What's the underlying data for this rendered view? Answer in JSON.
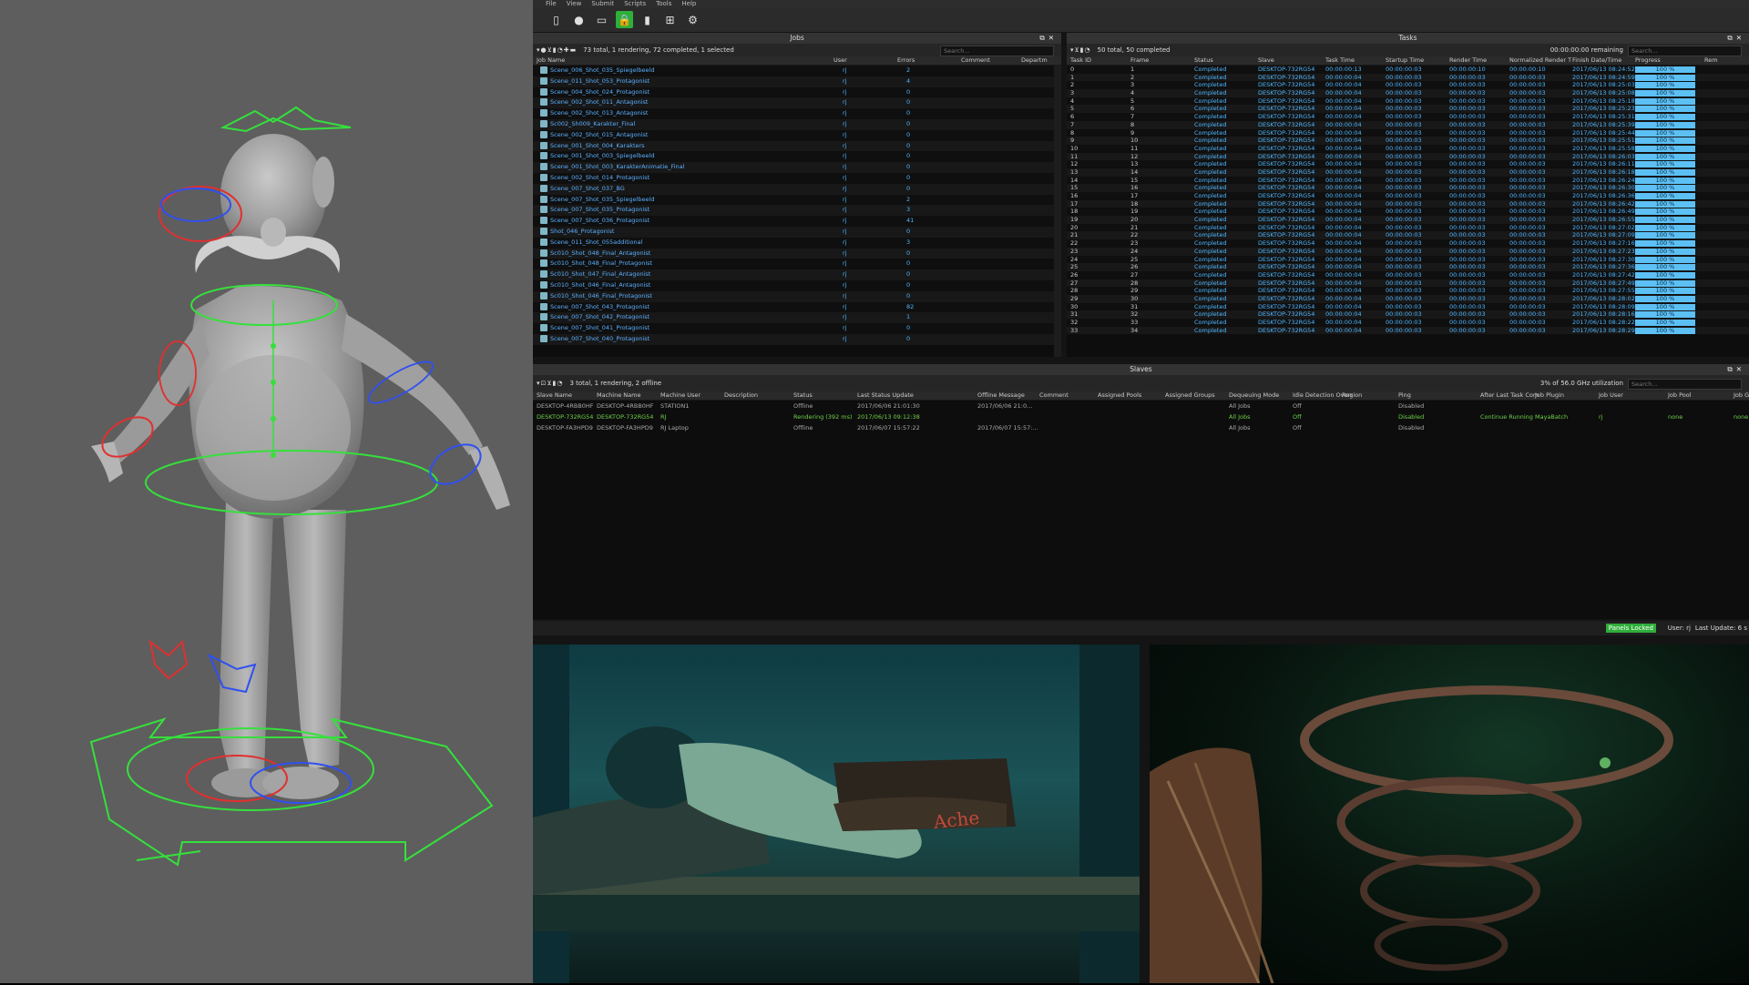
{
  "menu": [
    "File",
    "View",
    "Submit",
    "Scripts",
    "Tools",
    "Help"
  ],
  "toolbar_icons": [
    "monitor-icon",
    "user-icon",
    "window-icon",
    "lock-icon",
    "bookmark-icon",
    "network-icon",
    "gear-icon"
  ],
  "jobs": {
    "title": "Jobs",
    "summary": "73 total, 1 rendering, 72 completed, 1 selected",
    "search_placeholder": "Search...",
    "columns": [
      "Job Name",
      "User",
      "Errors",
      "Comment",
      "Departm"
    ],
    "rows": [
      {
        "name": "Scene_006_Shot_035_Spiegelbeeld",
        "user": "rj",
        "errors": "2"
      },
      {
        "name": "Scene_011_Shot_053_Protagonist",
        "user": "rj",
        "errors": "4"
      },
      {
        "name": "Scene_004_Shot_024_Protagonist",
        "user": "rj",
        "errors": "0"
      },
      {
        "name": "Scene_002_Shot_011_Antagonist",
        "user": "rj",
        "errors": "0"
      },
      {
        "name": "Scene_002_Shot_013_Antagonist",
        "user": "rj",
        "errors": "0"
      },
      {
        "name": "Sc002_Sh009_Karakter_Final",
        "user": "rj",
        "errors": "0"
      },
      {
        "name": "Scene_002_Shot_015_Antagonist",
        "user": "rj",
        "errors": "0"
      },
      {
        "name": "Scene_001_Shot_004_Karakters",
        "user": "rj",
        "errors": "0"
      },
      {
        "name": "Scene_001_Shot_003_Spiegelbeeld",
        "user": "rj",
        "errors": "0"
      },
      {
        "name": "Scene_001_Shot_003_KarakterAnimatie_Final",
        "user": "rj",
        "errors": "0"
      },
      {
        "name": "Scene_002_Shot_014_Protagonist",
        "user": "rj",
        "errors": "0"
      },
      {
        "name": "Scene_007_Shot_037_BG",
        "user": "rj",
        "errors": "0"
      },
      {
        "name": "Scene_007_Shot_035_Spiegelbeeld",
        "user": "rj",
        "errors": "2"
      },
      {
        "name": "Scene_007_Shot_035_Protagonist",
        "user": "rj",
        "errors": "3"
      },
      {
        "name": "Scene_007_Shot_036_Protagonist",
        "user": "rj",
        "errors": "41"
      },
      {
        "name": "Shot_046_Protagonist",
        "user": "rj",
        "errors": "0"
      },
      {
        "name": "Scene_011_Shot_055additional",
        "user": "rj",
        "errors": "3"
      },
      {
        "name": "Sc010_Shot_048_Final_Antagonist",
        "user": "rj",
        "errors": "0"
      },
      {
        "name": "Sc010_Shot_048_Final_Protagonist",
        "user": "rj",
        "errors": "0"
      },
      {
        "name": "Sc010_Shot_047_Final_Antagonist",
        "user": "rj",
        "errors": "0"
      },
      {
        "name": "Sc010_Shot_046_Final_Antagonist",
        "user": "rj",
        "errors": "0"
      },
      {
        "name": "Sc010_Shot_046_Final_Protagonist",
        "user": "rj",
        "errors": "0"
      },
      {
        "name": "Scene_007_Shot_043_Protagonist",
        "user": "rj",
        "errors": "82"
      },
      {
        "name": "Scene_007_Shot_042_Protagonist",
        "user": "rj",
        "errors": "1"
      },
      {
        "name": "Scene_007_Shot_041_Protagonist",
        "user": "rj",
        "errors": "0"
      },
      {
        "name": "Scene_007_Shot_040_Protagonist",
        "user": "rj",
        "errors": "0"
      }
    ]
  },
  "tasks": {
    "title": "Tasks",
    "summary": "50 total, 50 completed",
    "remaining": "00:00:00:00 remaining",
    "search_placeholder": "Search...",
    "columns": [
      "Task ID",
      "Frame",
      "Status",
      "Slave",
      "Task Time",
      "Startup Time",
      "Render Time",
      "Normalized Render T",
      "Finish Date/Time",
      "Progress",
      "Rem"
    ],
    "rows": [
      {
        "id": "0",
        "frame": "1",
        "status": "Completed",
        "slave": "DESKTOP-732RG54",
        "task_time": "00:00:00:13",
        "startup": "00:00:00:03",
        "render": "00:00:00:10",
        "norm": "00:00:00:10",
        "finish": "2017/06/13 08:24:52",
        "progress": "100 %"
      },
      {
        "id": "1",
        "frame": "2",
        "status": "Completed",
        "slave": "DESKTOP-732RG54",
        "task_time": "00:00:00:04",
        "startup": "00:00:00:03",
        "render": "00:00:00:03",
        "norm": "00:00:00:03",
        "finish": "2017/06/13 08:24:59",
        "progress": "100 %"
      },
      {
        "id": "2",
        "frame": "3",
        "status": "Completed",
        "slave": "DESKTOP-732RG54",
        "task_time": "00:00:00:04",
        "startup": "00:00:00:03",
        "render": "00:00:00:03",
        "norm": "00:00:00:03",
        "finish": "2017/06/13 08:25:03",
        "progress": "100 %"
      },
      {
        "id": "3",
        "frame": "4",
        "status": "Completed",
        "slave": "DESKTOP-732RG54",
        "task_time": "00:00:00:04",
        "startup": "00:00:00:03",
        "render": "00:00:00:03",
        "norm": "00:00:00:03",
        "finish": "2017/06/13 08:25:08",
        "progress": "100 %"
      },
      {
        "id": "4",
        "frame": "5",
        "status": "Completed",
        "slave": "DESKTOP-732RG54",
        "task_time": "00:00:00:04",
        "startup": "00:00:00:03",
        "render": "00:00:00:03",
        "norm": "00:00:00:03",
        "finish": "2017/06/13 08:25:18",
        "progress": "100 %"
      },
      {
        "id": "5",
        "frame": "6",
        "status": "Completed",
        "slave": "DESKTOP-732RG54",
        "task_time": "00:00:00:04",
        "startup": "00:00:00:03",
        "render": "00:00:00:03",
        "norm": "00:00:00:03",
        "finish": "2017/06/13 08:25:23",
        "progress": "100 %"
      },
      {
        "id": "6",
        "frame": "7",
        "status": "Completed",
        "slave": "DESKTOP-732RG54",
        "task_time": "00:00:00:04",
        "startup": "00:00:00:03",
        "render": "00:00:00:03",
        "norm": "00:00:00:03",
        "finish": "2017/06/13 08:25:31",
        "progress": "100 %"
      },
      {
        "id": "7",
        "frame": "8",
        "status": "Completed",
        "slave": "DESKTOP-732RG54",
        "task_time": "00:00:00:04",
        "startup": "00:00:00:03",
        "render": "00:00:00:03",
        "norm": "00:00:00:03",
        "finish": "2017/06/13 08:25:39",
        "progress": "100 %"
      },
      {
        "id": "8",
        "frame": "9",
        "status": "Completed",
        "slave": "DESKTOP-732RG54",
        "task_time": "00:00:00:04",
        "startup": "00:00:00:03",
        "render": "00:00:00:03",
        "norm": "00:00:00:03",
        "finish": "2017/06/13 08:25:44",
        "progress": "100 %"
      },
      {
        "id": "9",
        "frame": "10",
        "status": "Completed",
        "slave": "DESKTOP-732RG54",
        "task_time": "00:00:00:04",
        "startup": "00:00:00:03",
        "render": "00:00:00:03",
        "norm": "00:00:00:03",
        "finish": "2017/06/13 08:25:51",
        "progress": "100 %"
      },
      {
        "id": "10",
        "frame": "11",
        "status": "Completed",
        "slave": "DESKTOP-732RG54",
        "task_time": "00:00:00:04",
        "startup": "00:00:00:03",
        "render": "00:00:00:03",
        "norm": "00:00:00:03",
        "finish": "2017/06/13 08:25:58",
        "progress": "100 %"
      },
      {
        "id": "11",
        "frame": "12",
        "status": "Completed",
        "slave": "DESKTOP-732RG54",
        "task_time": "00:00:00:04",
        "startup": "00:00:00:03",
        "render": "00:00:00:03",
        "norm": "00:00:00:03",
        "finish": "2017/06/13 08:26:03",
        "progress": "100 %"
      },
      {
        "id": "12",
        "frame": "13",
        "status": "Completed",
        "slave": "DESKTOP-732RG54",
        "task_time": "00:00:00:04",
        "startup": "00:00:00:03",
        "render": "00:00:00:03",
        "norm": "00:00:00:03",
        "finish": "2017/06/13 08:26:11",
        "progress": "100 %"
      },
      {
        "id": "13",
        "frame": "14",
        "status": "Completed",
        "slave": "DESKTOP-732RG54",
        "task_time": "00:00:00:04",
        "startup": "00:00:00:03",
        "render": "00:00:00:03",
        "norm": "00:00:00:03",
        "finish": "2017/06/13 08:26:18",
        "progress": "100 %"
      },
      {
        "id": "14",
        "frame": "15",
        "status": "Completed",
        "slave": "DESKTOP-732RG54",
        "task_time": "00:00:00:04",
        "startup": "00:00:00:03",
        "render": "00:00:00:03",
        "norm": "00:00:00:03",
        "finish": "2017/06/13 08:26:24",
        "progress": "100 %"
      },
      {
        "id": "15",
        "frame": "16",
        "status": "Completed",
        "slave": "DESKTOP-732RG54",
        "task_time": "00:00:00:04",
        "startup": "00:00:00:03",
        "render": "00:00:00:03",
        "norm": "00:00:00:03",
        "finish": "2017/06/13 08:26:30",
        "progress": "100 %"
      },
      {
        "id": "16",
        "frame": "17",
        "status": "Completed",
        "slave": "DESKTOP-732RG54",
        "task_time": "00:00:00:04",
        "startup": "00:00:00:03",
        "render": "00:00:00:03",
        "norm": "00:00:00:03",
        "finish": "2017/06/13 08:26:36",
        "progress": "100 %"
      },
      {
        "id": "17",
        "frame": "18",
        "status": "Completed",
        "slave": "DESKTOP-732RG54",
        "task_time": "00:00:00:04",
        "startup": "00:00:00:03",
        "render": "00:00:00:03",
        "norm": "00:00:00:03",
        "finish": "2017/06/13 08:26:42",
        "progress": "100 %"
      },
      {
        "id": "18",
        "frame": "19",
        "status": "Completed",
        "slave": "DESKTOP-732RG54",
        "task_time": "00:00:00:04",
        "startup": "00:00:00:03",
        "render": "00:00:00:03",
        "norm": "00:00:00:03",
        "finish": "2017/06/13 08:26:49",
        "progress": "100 %"
      },
      {
        "id": "19",
        "frame": "20",
        "status": "Completed",
        "slave": "DESKTOP-732RG54",
        "task_time": "00:00:00:04",
        "startup": "00:00:00:03",
        "render": "00:00:00:03",
        "norm": "00:00:00:03",
        "finish": "2017/06/13 08:26:55",
        "progress": "100 %"
      },
      {
        "id": "20",
        "frame": "21",
        "status": "Completed",
        "slave": "DESKTOP-732RG54",
        "task_time": "00:00:00:04",
        "startup": "00:00:00:03",
        "render": "00:00:00:03",
        "norm": "00:00:00:03",
        "finish": "2017/06/13 08:27:02",
        "progress": "100 %"
      },
      {
        "id": "21",
        "frame": "22",
        "status": "Completed",
        "slave": "DESKTOP-732RG54",
        "task_time": "00:00:00:04",
        "startup": "00:00:00:03",
        "render": "00:00:00:03",
        "norm": "00:00:00:03",
        "finish": "2017/06/13 08:27:09",
        "progress": "100 %"
      },
      {
        "id": "22",
        "frame": "23",
        "status": "Completed",
        "slave": "DESKTOP-732RG54",
        "task_time": "00:00:00:04",
        "startup": "00:00:00:03",
        "render": "00:00:00:03",
        "norm": "00:00:00:03",
        "finish": "2017/06/13 08:27:16",
        "progress": "100 %"
      },
      {
        "id": "23",
        "frame": "24",
        "status": "Completed",
        "slave": "DESKTOP-732RG54",
        "task_time": "00:00:00:04",
        "startup": "00:00:00:03",
        "render": "00:00:00:03",
        "norm": "00:00:00:03",
        "finish": "2017/06/13 08:27:23",
        "progress": "100 %"
      },
      {
        "id": "24",
        "frame": "25",
        "status": "Completed",
        "slave": "DESKTOP-732RG54",
        "task_time": "00:00:00:04",
        "startup": "00:00:00:03",
        "render": "00:00:00:03",
        "norm": "00:00:00:03",
        "finish": "2017/06/13 08:27:30",
        "progress": "100 %"
      },
      {
        "id": "25",
        "frame": "26",
        "status": "Completed",
        "slave": "DESKTOP-732RG54",
        "task_time": "00:00:00:04",
        "startup": "00:00:00:03",
        "render": "00:00:00:03",
        "norm": "00:00:00:03",
        "finish": "2017/06/13 08:27:36",
        "progress": "100 %"
      },
      {
        "id": "26",
        "frame": "27",
        "status": "Completed",
        "slave": "DESKTOP-732RG54",
        "task_time": "00:00:00:04",
        "startup": "00:00:00:03",
        "render": "00:00:00:03",
        "norm": "00:00:00:03",
        "finish": "2017/06/13 08:27:42",
        "progress": "100 %"
      },
      {
        "id": "27",
        "frame": "28",
        "status": "Completed",
        "slave": "DESKTOP-732RG54",
        "task_time": "00:00:00:04",
        "startup": "00:00:00:03",
        "render": "00:00:00:03",
        "norm": "00:00:00:03",
        "finish": "2017/06/13 08:27:49",
        "progress": "100 %"
      },
      {
        "id": "28",
        "frame": "29",
        "status": "Completed",
        "slave": "DESKTOP-732RG54",
        "task_time": "00:00:00:04",
        "startup": "00:00:00:03",
        "render": "00:00:00:03",
        "norm": "00:00:00:03",
        "finish": "2017/06/13 08:27:55",
        "progress": "100 %"
      },
      {
        "id": "29",
        "frame": "30",
        "status": "Completed",
        "slave": "DESKTOP-732RG54",
        "task_time": "00:00:00:04",
        "startup": "00:00:00:03",
        "render": "00:00:00:03",
        "norm": "00:00:00:03",
        "finish": "2017/06/13 08:28:02",
        "progress": "100 %"
      },
      {
        "id": "30",
        "frame": "31",
        "status": "Completed",
        "slave": "DESKTOP-732RG54",
        "task_time": "00:00:00:04",
        "startup": "00:00:00:03",
        "render": "00:00:00:03",
        "norm": "00:00:00:03",
        "finish": "2017/06/13 08:28:09",
        "progress": "100 %"
      },
      {
        "id": "31",
        "frame": "32",
        "status": "Completed",
        "slave": "DESKTOP-732RG54",
        "task_time": "00:00:00:04",
        "startup": "00:00:00:03",
        "render": "00:00:00:03",
        "norm": "00:00:00:03",
        "finish": "2017/06/13 08:28:16",
        "progress": "100 %"
      },
      {
        "id": "32",
        "frame": "33",
        "status": "Completed",
        "slave": "DESKTOP-732RG54",
        "task_time": "00:00:00:04",
        "startup": "00:00:00:03",
        "render": "00:00:00:03",
        "norm": "00:00:00:03",
        "finish": "2017/06/13 08:28:22",
        "progress": "100 %"
      },
      {
        "id": "33",
        "frame": "34",
        "status": "Completed",
        "slave": "DESKTOP-732RG54",
        "task_time": "00:00:00:04",
        "startup": "00:00:00:03",
        "render": "00:00:00:03",
        "norm": "00:00:00:03",
        "finish": "2017/06/13 08:28:29",
        "progress": "100 %"
      }
    ]
  },
  "slaves": {
    "title": "Slaves",
    "summary": "3 total, 1 rendering, 2 offline",
    "utilization": "3% of 56.0 GHz utilization",
    "search_placeholder": "Search...",
    "columns": [
      "Slave Name",
      "Machine Name",
      "Machine User",
      "Description",
      "Status",
      "Last Status Update",
      "Offline Message",
      "Comment",
      "Assigned Pools",
      "Assigned Groups",
      "Dequeuing Mode",
      "Idle Detection Overr",
      "Region",
      "Ping",
      "After Last Task Com",
      "Job Plugin",
      "Job User",
      "Job Pool",
      "Job G"
    ],
    "rows": [
      {
        "slave": "DESKTOP-4RBB0HF",
        "machine": "DESKTOP-4RBB0HF",
        "user": "STATION1",
        "status": "Offline",
        "last_update": "2017/06/06 21:01:30",
        "offline": "2017/06/06 21:0...",
        "dequeue": "All Jobs",
        "idle": "Off",
        "ping": "Disabled",
        "after": "",
        "plugin": "",
        "job_user": "",
        "pool": "",
        "group": ""
      },
      {
        "slave": "DESKTOP-732RG54",
        "machine": "DESKTOP-732RG54",
        "user": "RJ",
        "status": "Rendering (392 ms)",
        "last_update": "2017/06/13 09:12:38",
        "offline": "",
        "dequeue": "All Jobs",
        "idle": "Off",
        "ping": "Disabled",
        "after": "Continue Running",
        "plugin": "MayaBatch",
        "job_user": "rj",
        "pool": "none",
        "group": "none"
      },
      {
        "slave": "DESKTOP-FA3HPD9",
        "machine": "DESKTOP-FA3HPD9",
        "user": "RJ Laptop",
        "status": "Offline",
        "last_update": "2017/06/07 15:57:22",
        "offline": "2017/06/07 15:57:...",
        "dequeue": "All Jobs",
        "idle": "Off",
        "ping": "Disabled",
        "after": "",
        "plugin": "",
        "job_user": "",
        "pool": "",
        "group": ""
      }
    ]
  },
  "status": {
    "panels_locked": "Panels Locked",
    "user": "User: rj",
    "last_update": "Last Update: 6 s"
  },
  "render_text": "Ache",
  "colors": {
    "accent_green": "#2fae3a",
    "progress_blue": "#5cc0f4",
    "job_link": "#5ab0ff",
    "rendering_green": "#6fd14a",
    "rig_green": "#35e03c",
    "rig_red": "#e03030",
    "rig_blue": "#3050f0"
  }
}
